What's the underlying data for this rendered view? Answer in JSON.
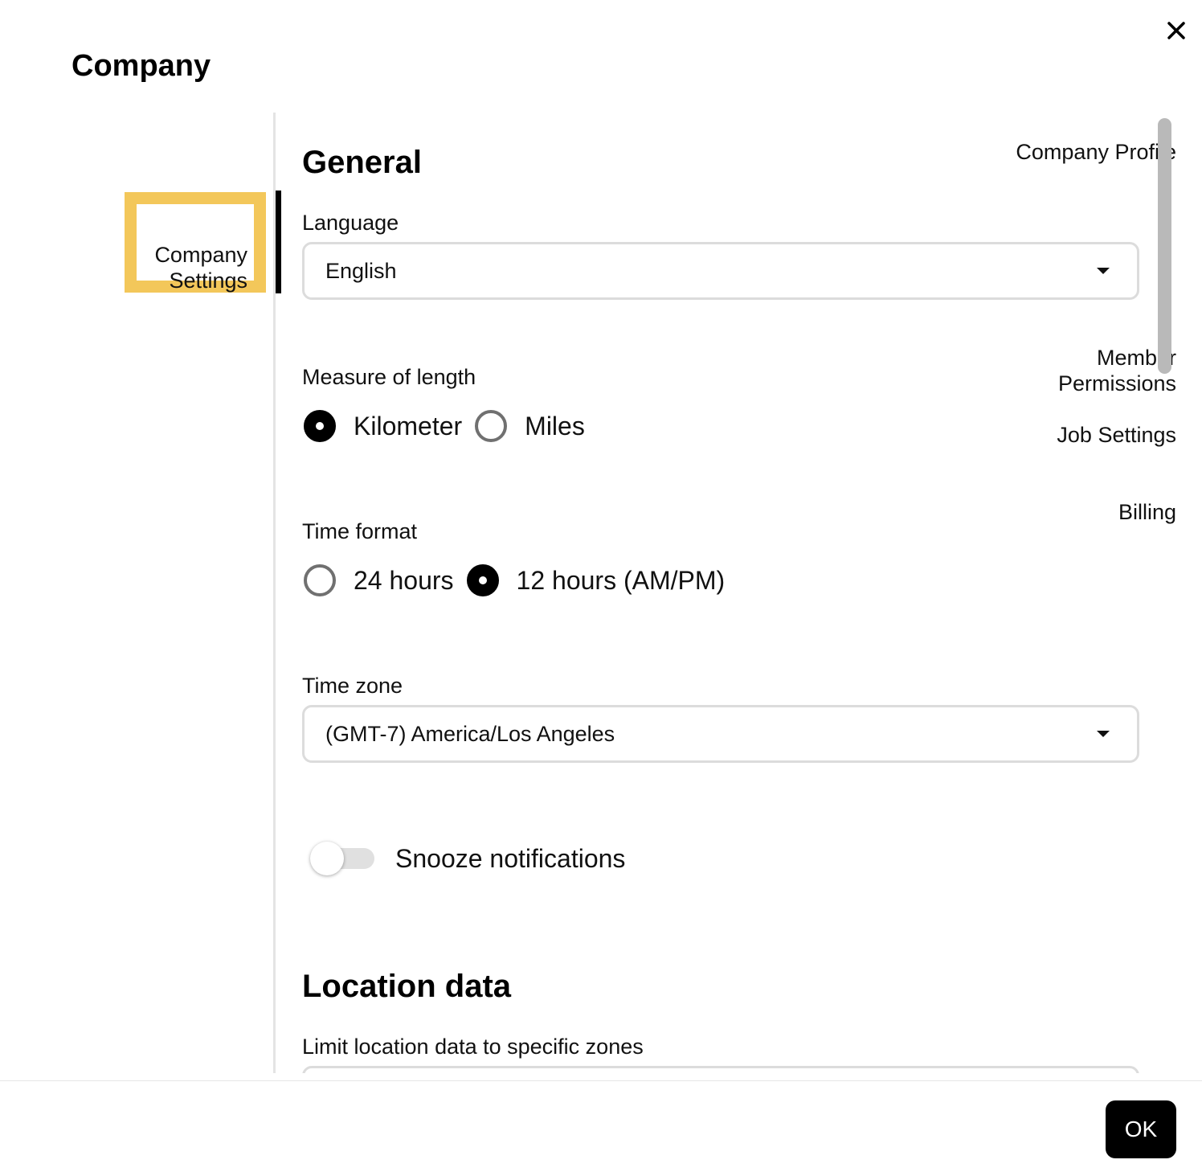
{
  "dialog": {
    "title": "Company",
    "close_icon": "close-icon"
  },
  "sidebar": {
    "items": [
      {
        "label": "Company Profile",
        "active": false
      },
      {
        "label": "Company\nSettings",
        "active": true
      },
      {
        "label": "Member\nPermissions",
        "active": false
      },
      {
        "label": "Job Settings",
        "active": false
      },
      {
        "label": "Billing",
        "active": false
      }
    ],
    "active_highlight_color": "#f3c75a"
  },
  "general": {
    "heading": "General",
    "language": {
      "label": "Language",
      "value": "English",
      "icon": "caret-down-icon"
    },
    "length": {
      "label": "Measure of length",
      "options": [
        {
          "label": "Kilometer",
          "checked": true
        },
        {
          "label": "Miles",
          "checked": false
        }
      ]
    },
    "time_format": {
      "label": "Time format",
      "options": [
        {
          "label": "24 hours",
          "checked": false
        },
        {
          "label": "12 hours (AM/PM)",
          "checked": true
        }
      ]
    },
    "time_zone": {
      "label": "Time zone",
      "value": "(GMT-7) America/Los Angeles",
      "icon": "caret-down-icon"
    },
    "snooze": {
      "label": "Snooze notifications",
      "enabled": false
    }
  },
  "location": {
    "heading": "Location data",
    "limit_label": "Limit location data to specific zones"
  },
  "footer": {
    "ok_label": "OK"
  },
  "colors": {
    "primary": "#000000",
    "border": "#dcdcdc",
    "highlight": "#f3c75a"
  }
}
